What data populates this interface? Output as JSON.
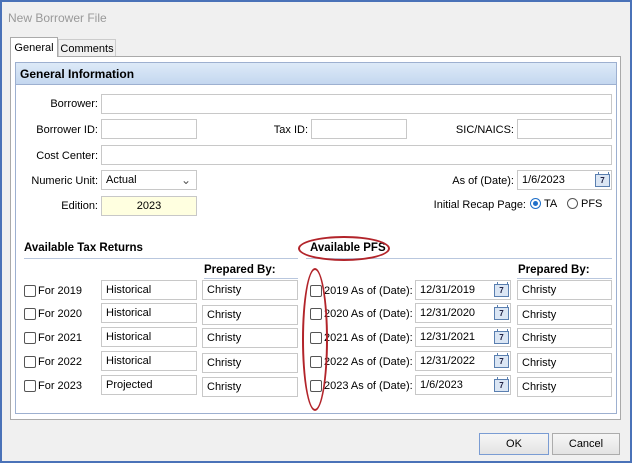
{
  "window": {
    "title": "New Borrower File"
  },
  "tabs": [
    {
      "label": "General"
    },
    {
      "label": "Comments"
    }
  ],
  "general": {
    "header": "General Information",
    "borrower": {
      "label": "Borrower:",
      "value": ""
    },
    "borrower_id": {
      "label": "Borrower ID:",
      "value": ""
    },
    "tax_id": {
      "label": "Tax ID:",
      "value": ""
    },
    "sic": {
      "label": "SIC/NAICS:",
      "value": ""
    },
    "cost_center": {
      "label": "Cost Center:",
      "value": ""
    },
    "numeric_unit": {
      "label": "Numeric Unit:",
      "value": "Actual"
    },
    "edition": {
      "label": "Edition:",
      "value": "2023",
      "highlight": "#ffffe0"
    },
    "as_of": {
      "label": "As of (Date):",
      "value": "1/6/2023"
    },
    "recap": {
      "label": "Initial Recap Page:",
      "options": [
        "TA",
        "PFS"
      ],
      "selected": "TA"
    }
  },
  "tax_returns": {
    "title": "Available Tax Returns",
    "prepared_by_label": "Prepared By:",
    "rows": [
      {
        "label": "For 2019",
        "type": "Historical",
        "prepared_by": "Christy",
        "checked": false
      },
      {
        "label": "For 2020",
        "type": "Historical",
        "prepared_by": "Christy",
        "checked": false
      },
      {
        "label": "For 2021",
        "type": "Historical",
        "prepared_by": "Christy",
        "checked": false
      },
      {
        "label": "For 2022",
        "type": "Historical",
        "prepared_by": "Christy",
        "checked": false
      },
      {
        "label": "For 2023",
        "type": "Projected",
        "prepared_by": "Christy",
        "checked": false
      }
    ]
  },
  "pfs": {
    "title": "Available PFS",
    "prepared_by_label": "Prepared By:",
    "rows": [
      {
        "label": "2019 As of (Date):",
        "date": "12/31/2019",
        "prepared_by": "Christy",
        "checked": false
      },
      {
        "label": "2020 As of (Date):",
        "date": "12/31/2020",
        "prepared_by": "Christy",
        "checked": false
      },
      {
        "label": "2021 As of (Date):",
        "date": "12/31/2021",
        "prepared_by": "Christy",
        "checked": false
      },
      {
        "label": "2022 As of (Date):",
        "date": "12/31/2022",
        "prepared_by": "Christy",
        "checked": false
      },
      {
        "label": "2023 As of (Date):",
        "date": "1/6/2023",
        "prepared_by": "Christy",
        "checked": false
      }
    ]
  },
  "buttons": {
    "ok": "OK",
    "cancel": "Cancel"
  },
  "colors": {
    "frame": "#4a72b8",
    "annotation": "#b2242a",
    "header": "#c4d7ef",
    "radio": "#1f6fc9"
  },
  "icons": {
    "calendar": "calendar-icon",
    "dropdown": "chevron-down-icon"
  }
}
